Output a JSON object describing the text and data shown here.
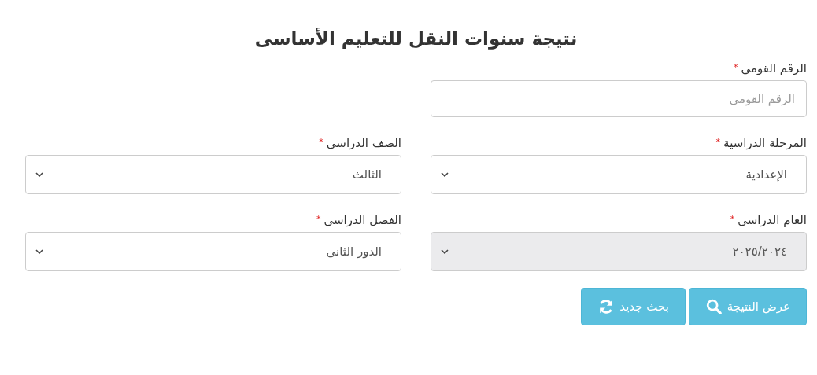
{
  "title": "نتيجة سنوات النقل للتعليم الأساسى",
  "rows": [
    [
      {
        "label": "الرقم القومى",
        "required": true,
        "kind": "text",
        "placeholder": "الرقم القومى",
        "disabled": false
      }
    ],
    [
      {
        "label": "المرحلة الدراسية",
        "required": true,
        "kind": "select",
        "value": "الإعدادية",
        "disabled": false
      },
      {
        "label": "الصف الدراسى",
        "required": true,
        "kind": "select",
        "value": "الثالث",
        "disabled": false
      }
    ],
    [
      {
        "label": "العام الدراسى",
        "required": true,
        "kind": "select",
        "value": "٢٠٢٥/٢٠٢٤",
        "disabled": true
      },
      {
        "label": "الفصل الدراسى",
        "required": true,
        "kind": "select",
        "value": "الدور الثانى",
        "disabled": false
      }
    ]
  ],
  "required_mark": "*",
  "buttons": [
    {
      "label": "عرض النتيجة",
      "kind": "search"
    },
    {
      "label": "بحث جديد",
      "kind": "refresh"
    }
  ]
}
